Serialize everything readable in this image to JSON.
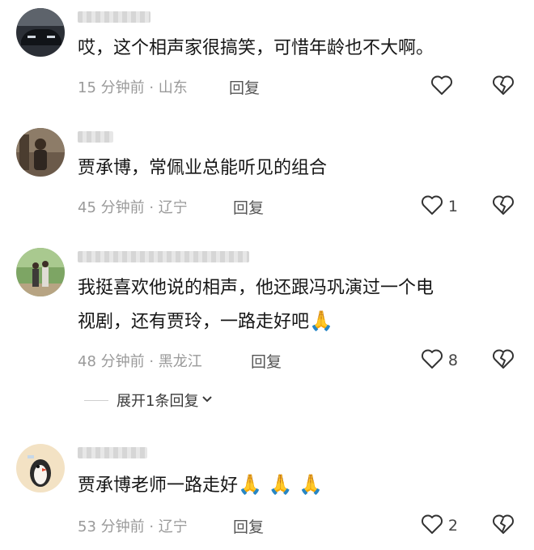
{
  "comments": [
    {
      "text": "哎，这个相声家很搞笑，可惜年龄也不大啊。",
      "meta": "15 分钟前 · 山东",
      "reply": "回复",
      "likes": ""
    },
    {
      "text": "贾承博，常佩业总能听见的组合",
      "meta": "45 分钟前 · 辽宁",
      "reply": "回复",
      "likes": "1"
    },
    {
      "text": "我挺喜欢他说的相声，他还跟冯巩演过一个电视剧，还有贾玲，一路走好吧",
      "emoji": "🙏",
      "meta": "48 分钟前 · 黑龙江",
      "reply": "回复",
      "likes": "8"
    },
    {
      "text": "贾承博老师一路走好",
      "emoji": "🙏 🙏 🙏",
      "meta": "53 分钟前 · 辽宁",
      "reply": "回复",
      "likes": "2"
    }
  ],
  "expand_replies": "展开1条回复",
  "icons": {
    "like": "heart-outline-icon",
    "dislike": "broken-heart-icon",
    "expand": "chevron-down-icon"
  }
}
